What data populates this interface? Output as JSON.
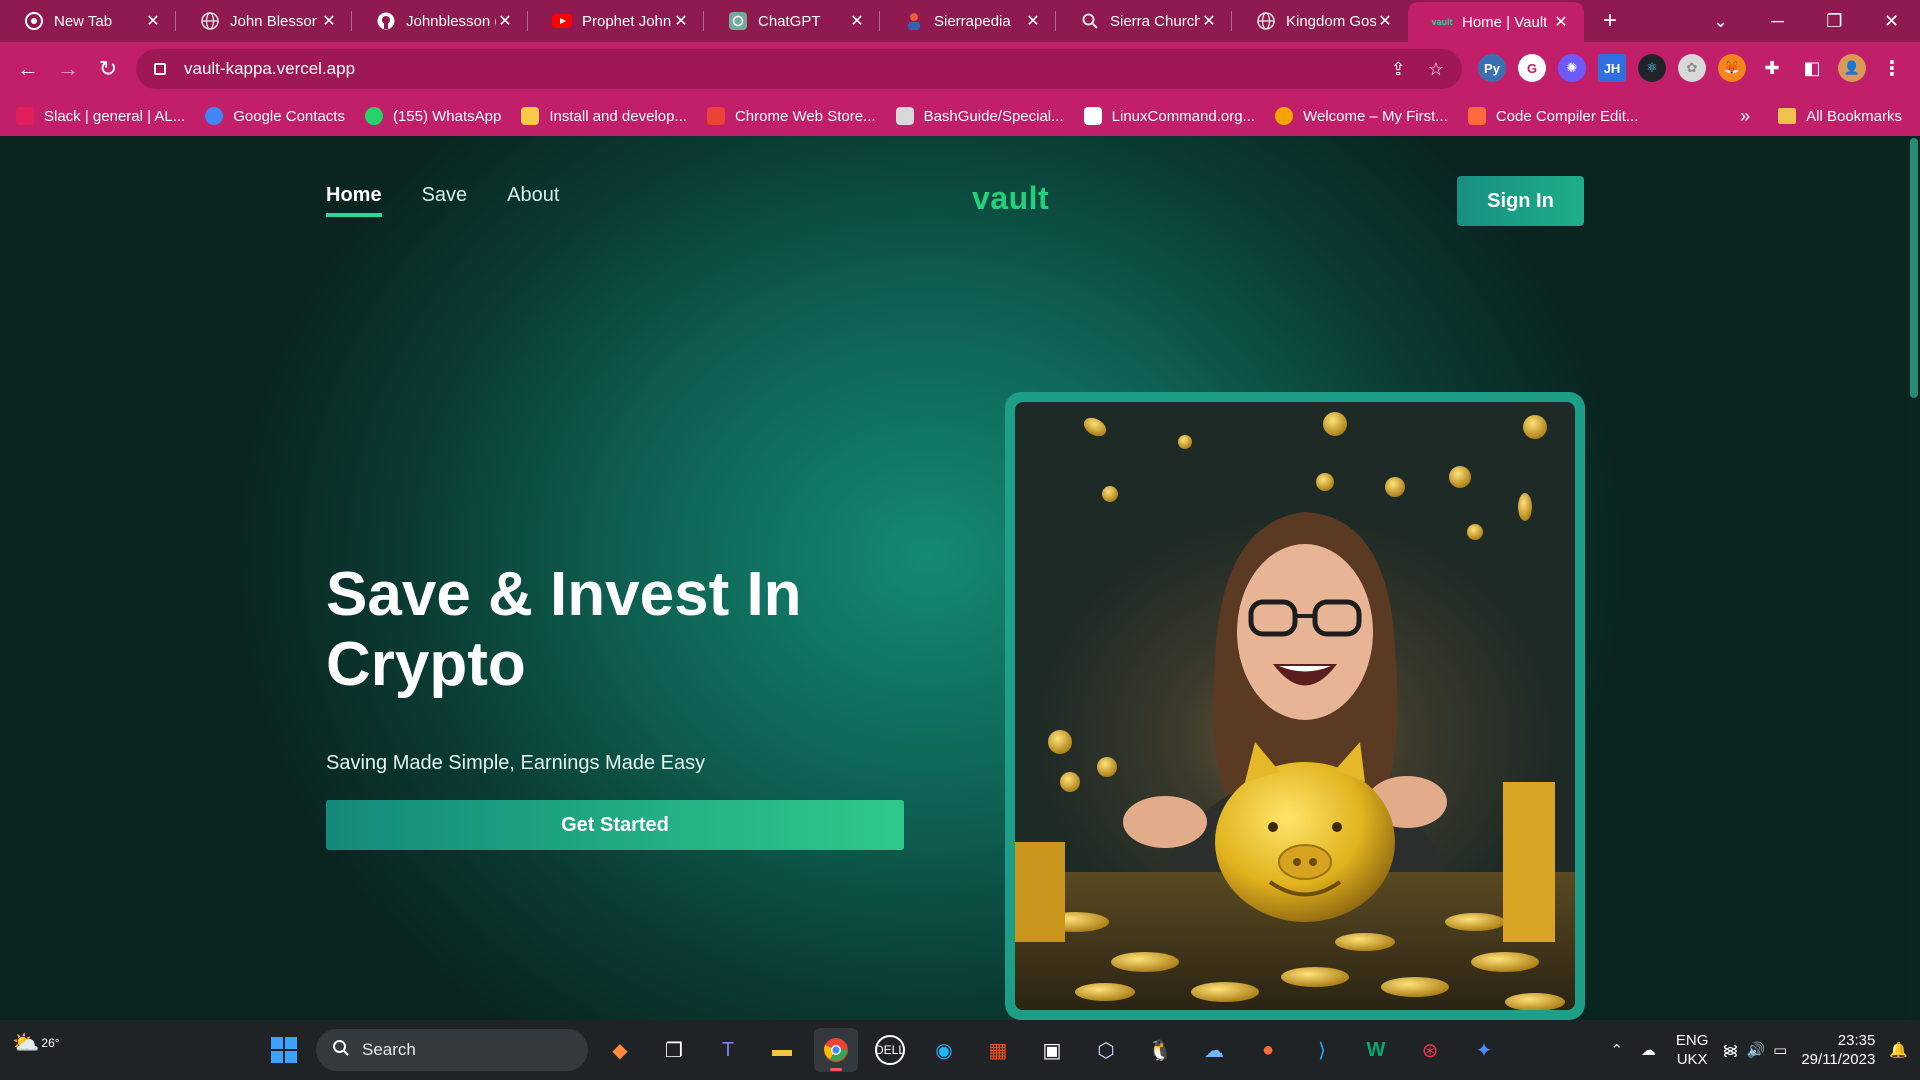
{
  "browser": {
    "tabs": [
      {
        "title": "New Tab",
        "icon": "chrome-icon",
        "active": false
      },
      {
        "title": "John Blessor",
        "icon": "globe-icon",
        "active": false
      },
      {
        "title": "Johnblesson (",
        "icon": "github-icon",
        "active": false
      },
      {
        "title": "Prophet John",
        "icon": "youtube-icon",
        "active": false
      },
      {
        "title": "ChatGPT",
        "icon": "chatgpt-icon",
        "active": false
      },
      {
        "title": "Sierrapedia",
        "icon": "person-icon",
        "active": false
      },
      {
        "title": "Sierra Church",
        "icon": "search-icon",
        "active": false
      },
      {
        "title": "Kingdom Gos",
        "icon": "globe-icon",
        "active": false
      },
      {
        "title": "Home | Vault",
        "icon": "vault-icon",
        "active": true
      }
    ],
    "new_tab": "+",
    "url": "vault-kappa.vercel.app",
    "bookmarks": [
      {
        "label": "Slack | general | AL...",
        "color": "#e01e5a"
      },
      {
        "label": "Google Contacts",
        "color": "#4285f4"
      },
      {
        "label": "(155) WhatsApp",
        "color": "#25d366"
      },
      {
        "label": "Install and develop...",
        "color": "#f7c948"
      },
      {
        "label": "Chrome Web Store...",
        "color": "#ea4335"
      },
      {
        "label": "BashGuide/Special...",
        "color": "#d9d9d9"
      },
      {
        "label": "LinuxCommand.org...",
        "color": "#ffffff"
      },
      {
        "label": "Welcome – My First...",
        "color": "#f4a300"
      },
      {
        "label": "Code Compiler Edit...",
        "color": "#ff6a3d"
      }
    ],
    "bookmarks_more": "»",
    "all_bookmarks": "All Bookmarks"
  },
  "site": {
    "nav": [
      {
        "label": "Home",
        "active": true
      },
      {
        "label": "Save",
        "active": false
      },
      {
        "label": "About",
        "active": false
      }
    ],
    "logo": "vault",
    "signin": "Sign In",
    "hero": {
      "title": "Save & Invest In Crypto",
      "subtitle": "Saving Made Simple, Earnings Made Easy",
      "cta": "Get Started"
    }
  },
  "taskbar": {
    "temperature": "26°",
    "search": "Search",
    "lang_line1": "ENG",
    "lang_line2": "UKX",
    "time": "23:35",
    "date": "29/11/2023"
  },
  "colors": {
    "chrome_tabbar": "#8e1a4f",
    "chrome_toolbar": "#c21f6b",
    "brand_green": "#25d07c",
    "page_teal": "#138a74"
  }
}
